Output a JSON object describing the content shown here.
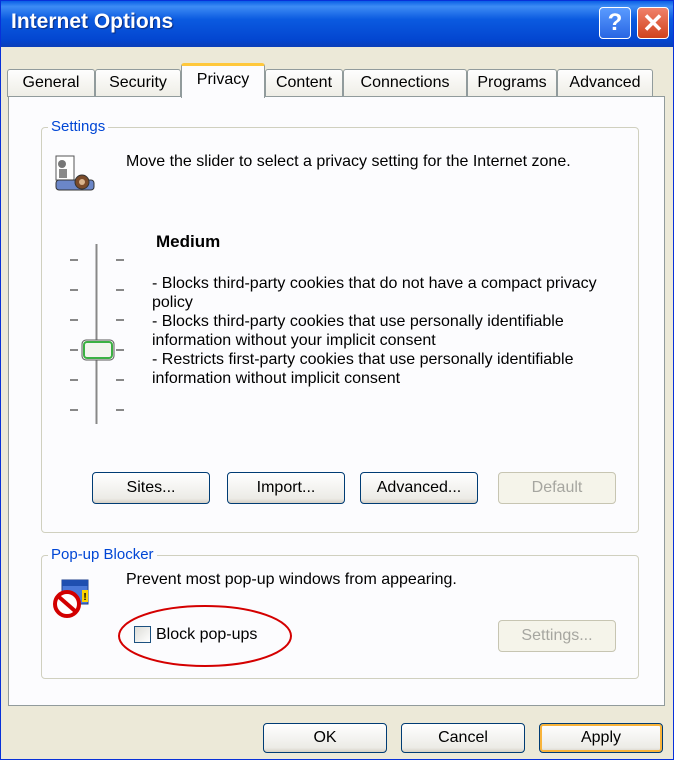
{
  "window": {
    "title": "Internet Options"
  },
  "tabs": [
    {
      "label": "General"
    },
    {
      "label": "Security"
    },
    {
      "label": "Privacy"
    },
    {
      "label": "Content"
    },
    {
      "label": "Connections"
    },
    {
      "label": "Programs"
    },
    {
      "label": "Advanced"
    }
  ],
  "settings": {
    "group_label": "Settings",
    "instruction": "Move the slider to select a privacy setting for the Internet zone.",
    "level": "Medium",
    "slider_level": "3 of 6",
    "description": [
      "- Blocks third-party cookies that do not have a compact privacy policy",
      "- Blocks third-party cookies that use personally identifiable information without your implicit consent",
      "- Restricts first-party cookies that use personally identifiable information without implicit consent"
    ],
    "buttons": {
      "sites": "Sites...",
      "import": "Import...",
      "advanced": "Advanced...",
      "default": "Default"
    }
  },
  "popup": {
    "group_label": "Pop-up Blocker",
    "description": "Prevent most pop-up windows from appearing.",
    "checkbox_label": "Block pop-ups",
    "checked": false,
    "settings_button": "Settings..."
  },
  "footer": {
    "ok": "OK",
    "cancel": "Cancel",
    "apply": "Apply"
  },
  "colors": {
    "titlebar": "#0a5fe6",
    "highlight_circle": "#d40000",
    "group_label": "#0046d5"
  }
}
